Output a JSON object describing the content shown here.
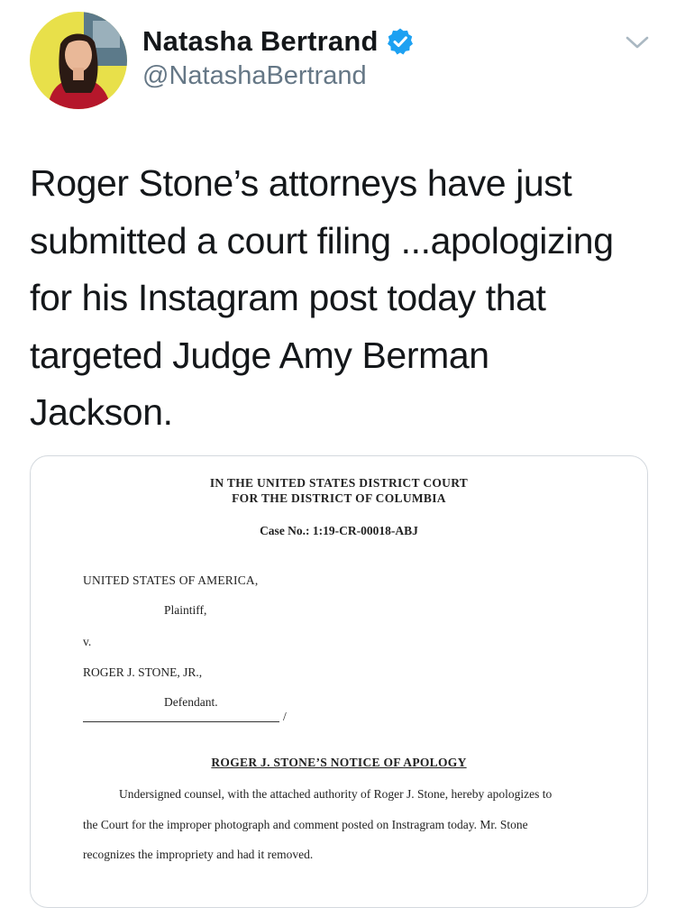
{
  "author": {
    "display_name": "Natasha Bertrand",
    "handle": "@NatashaBertrand",
    "verified_icon": "verified-badge-icon",
    "avatar_icon": "profile-photo"
  },
  "menu": {
    "icon": "chevron-down-icon"
  },
  "tweet": {
    "lines": [
      "Roger Stone’s attorneys have just",
      "submitted a court filing ...apologizing",
      "for his Instagram post today that",
      "targeted Judge Amy Berman",
      "Jackson."
    ]
  },
  "document": {
    "court_line1": "IN THE UNITED STATES DISTRICT COURT",
    "court_line2": "FOR THE DISTRICT OF COLUMBIA",
    "case_number": "Case No.: 1:19-CR-00018-ABJ",
    "plaintiff_name": "UNITED STATES OF AMERICA,",
    "plaintiff_label": "Plaintiff,",
    "versus": "v.",
    "defendant_name": "ROGER J. STONE, JR.,",
    "defendant_label": "Defendant.",
    "slash": "/",
    "title": "ROGER J. STONE’S NOTICE OF APOLOGY",
    "paragraph_lines": [
      "Undersigned counsel, with the attached authority of Roger J. Stone, hereby apologizes to",
      "the Court for the improper photograph and comment posted on Instragram today. Mr. Stone",
      "recognizes the impropriety and had it removed."
    ]
  },
  "colors": {
    "text": "#14171a",
    "secondary": "#657786",
    "verified_blue": "#1da1f2",
    "card_border": "#d4d9de"
  }
}
